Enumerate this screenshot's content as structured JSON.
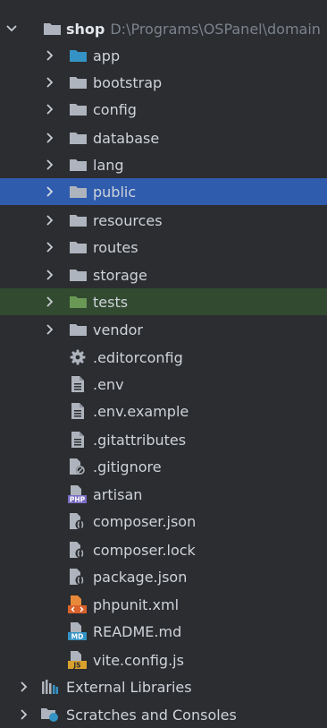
{
  "colors": {
    "background": "#2b2d30",
    "selection": "#2f5cad",
    "tests_highlight": "#314a30",
    "folder": "#aeb4bd",
    "folder_accent": "#3592c4",
    "folder_tests": "#6a9955"
  },
  "root": {
    "name": "shop",
    "path": "D:\\Programs\\OSPanel\\domain",
    "icon": "folder-icon"
  },
  "folders": [
    {
      "label": "app",
      "icon": "folder-icon"
    },
    {
      "label": "bootstrap",
      "icon": "folder-icon"
    },
    {
      "label": "config",
      "icon": "folder-icon"
    },
    {
      "label": "database",
      "icon": "folder-icon"
    },
    {
      "label": "lang",
      "icon": "folder-icon"
    },
    {
      "label": "public",
      "icon": "folder-icon"
    },
    {
      "label": "resources",
      "icon": "folder-icon"
    },
    {
      "label": "routes",
      "icon": "folder-icon"
    },
    {
      "label": "storage",
      "icon": "folder-icon"
    },
    {
      "label": "tests",
      "icon": "folder-icon"
    },
    {
      "label": "vendor",
      "icon": "folder-icon"
    }
  ],
  "files": [
    {
      "label": ".editorconfig",
      "icon": "gear-icon"
    },
    {
      "label": ".env",
      "icon": "text-file-icon"
    },
    {
      "label": ".env.example",
      "icon": "text-file-icon"
    },
    {
      "label": ".gitattributes",
      "icon": "text-file-icon"
    },
    {
      "label": ".gitignore",
      "icon": "ignore-file-icon"
    },
    {
      "label": "artisan",
      "icon": "php-file-icon",
      "badge": "PHP"
    },
    {
      "label": "composer.json",
      "icon": "composer-file-icon"
    },
    {
      "label": "composer.lock",
      "icon": "composer-file-icon"
    },
    {
      "label": "package.json",
      "icon": "composer-file-icon"
    },
    {
      "label": "phpunit.xml",
      "icon": "xml-file-icon"
    },
    {
      "label": "README.md",
      "icon": "markdown-file-icon",
      "badge": "MD"
    },
    {
      "label": "vite.config.js",
      "icon": "js-file-icon",
      "badge": "JS"
    }
  ],
  "bottom": [
    {
      "label": "External Libraries",
      "icon": "libraries-icon"
    },
    {
      "label": "Scratches and Consoles",
      "icon": "scratches-icon"
    }
  ]
}
